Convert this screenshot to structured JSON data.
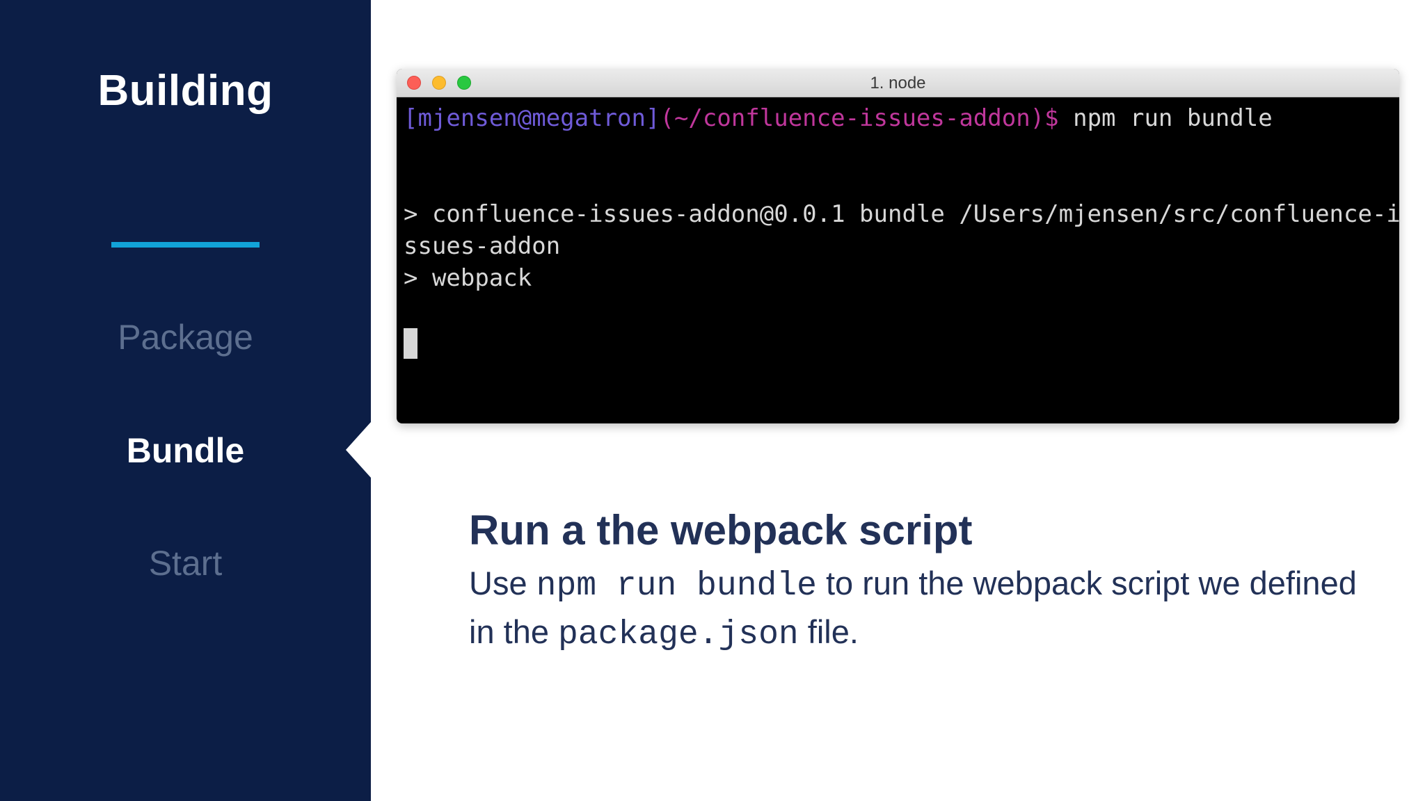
{
  "sidebar": {
    "title": "Building",
    "items": [
      {
        "label": "Package",
        "state": "inactive"
      },
      {
        "label": "Bundle",
        "state": "active"
      },
      {
        "label": "Start",
        "state": "inactive"
      }
    ],
    "background_color": "#0c1e46",
    "accent_color": "#12a3d8"
  },
  "terminal": {
    "window_title": "1. node",
    "prompt_user": "[mjensen@megatron]",
    "prompt_path": "(~/confluence-issues-addon)$",
    "command": " npm run bundle",
    "output_line1": "> confluence-issues-addon@0.0.1 bundle /Users/mjensen/src/confluence-i",
    "output_line2": "ssues-addon",
    "output_line3": "> webpack"
  },
  "content": {
    "heading": "Run a the webpack script",
    "text_part1": "Use ",
    "code1": "npm run bundle",
    "text_part2": " to run the webpack script we defined in the ",
    "code2": "package.json",
    "text_part3": " file."
  }
}
